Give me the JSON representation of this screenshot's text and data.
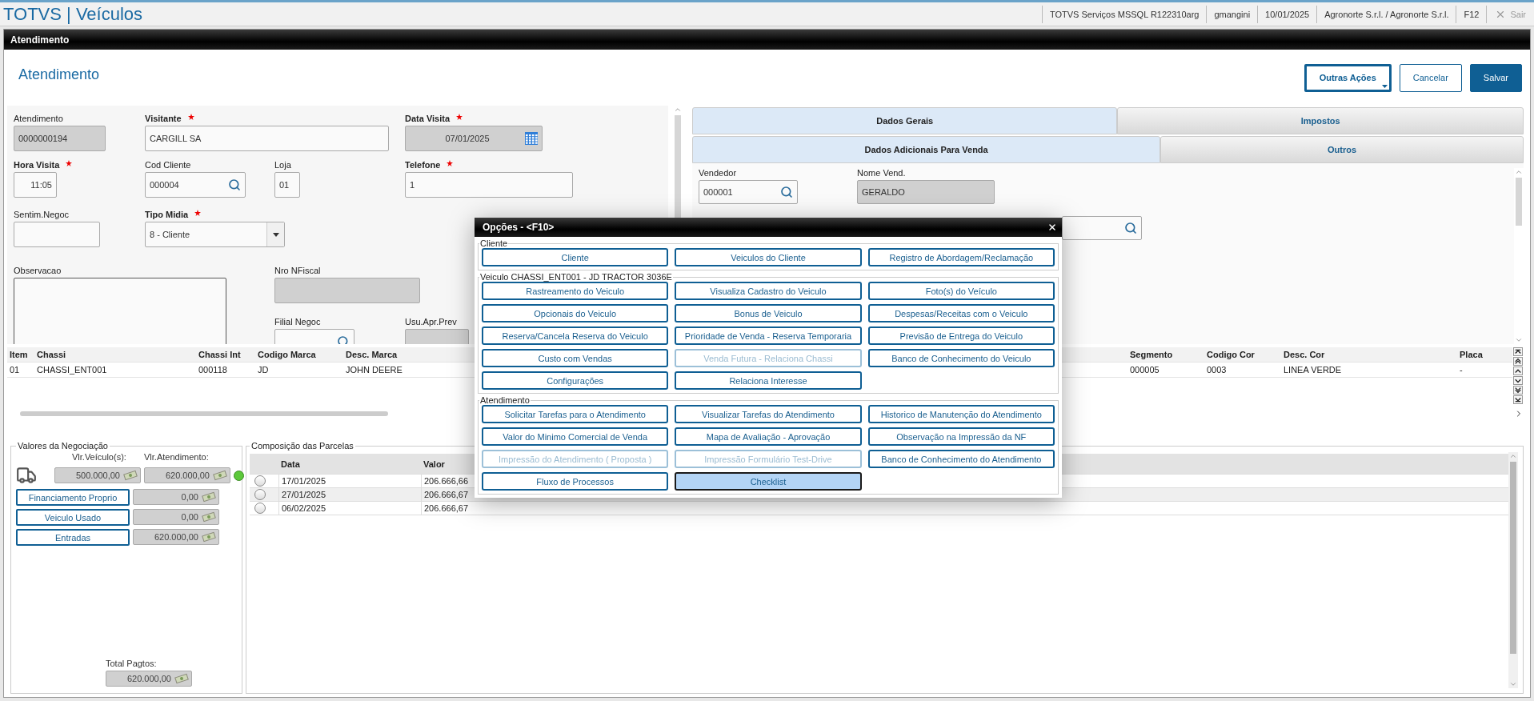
{
  "app": {
    "title": "TOTVS | Veículos",
    "status_items": [
      "TOTVS Serviços MSSQL R122310arg",
      "gmangini",
      "10/01/2025",
      "Agronorte S.r.l. / Agronorte S.r.l.",
      "F12"
    ],
    "exit": {
      "label": "Sair",
      "disabled": true
    }
  },
  "window": {
    "title": "Atendimento"
  },
  "header": {
    "title": "Atendimento",
    "buttons": [
      {
        "label": "Outras Ações",
        "kind": "menu"
      },
      {
        "label": "Cancelar",
        "kind": "secondary"
      },
      {
        "label": "Salvar",
        "kind": "primary"
      }
    ]
  },
  "form": {
    "fields": [
      {
        "label": "Atendimento",
        "required": false,
        "kind": "text",
        "readonly": true,
        "value": "0000000194"
      },
      {
        "label": "Visitante",
        "required": true,
        "kind": "text",
        "readonly": false,
        "value": "CARGILL SA"
      },
      {
        "label": "Data Visita",
        "required": true,
        "kind": "date",
        "readonly": true,
        "value": "07/01/2025"
      },
      {
        "label": "Hora Visita",
        "required": true,
        "kind": "time",
        "readonly": false,
        "value": "11:05"
      },
      {
        "label": "Cod Cliente",
        "required": false,
        "kind": "lookup",
        "readonly": false,
        "value": "000004"
      },
      {
        "label": "Loja",
        "required": false,
        "kind": "text",
        "readonly": false,
        "value": "01"
      },
      {
        "label": "Telefone",
        "required": true,
        "kind": "text",
        "readonly": false,
        "value": "1"
      },
      {
        "label": "Sentim.Negoc",
        "required": false,
        "kind": "text",
        "readonly": false
      },
      {
        "label": "Tipo Midia",
        "required": true,
        "kind": "select",
        "readonly": false,
        "value": "8 - Cliente"
      },
      {
        "label": "Observacao",
        "required": false,
        "kind": "textarea",
        "readonly": false
      },
      {
        "label": "Nro NFiscal",
        "required": false,
        "kind": "text",
        "readonly": true
      },
      {
        "label": "Filial Negoc",
        "required": false,
        "kind": "lookup",
        "readonly": false
      },
      {
        "label": "Usu.Apr.Prev",
        "required": false,
        "kind": "text",
        "readonly": true
      }
    ]
  },
  "tab_rows": [
    {
      "tabs": [
        {
          "label": "Dados Gerais",
          "selected": true
        },
        {
          "label": "Impostos",
          "selected": false
        }
      ]
    },
    {
      "tabs": [
        {
          "label": "Dados Adicionais Para Venda",
          "selected": true
        },
        {
          "label": "Outros",
          "selected": false
        }
      ]
    }
  ],
  "tab_fields": [
    {
      "label": "Vendedor",
      "kind": "lookup",
      "readonly": false,
      "value": "000001"
    },
    {
      "label": "Nome Vend.",
      "kind": "text",
      "readonly": true,
      "value": "GERALDO"
    },
    {
      "kind": "lookup",
      "readonly": false
    }
  ],
  "vehicles": {
    "columns": [
      "Item",
      "Chassi",
      "Chassi Int",
      "Codigo Marca",
      "Desc. Marca",
      "Segmento",
      "Codigo Cor",
      "Desc. Cor",
      "Placa"
    ],
    "rows": [
      [
        "01",
        "CHASSI_ENT001",
        "000118",
        "JD",
        "JOHN DEERE",
        "000005",
        "0003",
        "LINEA VERDE",
        "-"
      ]
    ]
  },
  "negotiation": {
    "title": "Valores da Negociação",
    "vehicle_label": "Vlr.Veículo(s):",
    "vehicle_value": "500.000,00",
    "service_label": "Vlr.Atendimento:",
    "service_value": "620.000,00",
    "balanced": true,
    "entries": [
      {
        "label": "Financiamento Proprio",
        "value": "0,00"
      },
      {
        "label": "Veiculo Usado",
        "value": "0,00"
      },
      {
        "label": "Entradas",
        "value": "620.000,00"
      }
    ],
    "total_label": "Total Pagtos:",
    "total_value": "620.000,00"
  },
  "installments": {
    "title": "Composição das Parcelas",
    "columns": [
      "Data",
      "Valor"
    ],
    "rows": [
      {
        "selected": false,
        "cells": [
          "17/01/2025",
          "206.666,66"
        ]
      },
      {
        "selected": false,
        "cells": [
          "27/01/2025",
          "206.666,67"
        ]
      },
      {
        "selected": false,
        "cells": [
          "06/02/2025",
          "206.666,67"
        ]
      }
    ]
  },
  "dialog": {
    "title": "Opções - <F10>",
    "groups": [
      {
        "title": "Cliente",
        "buttons": [
          {
            "label": "Cliente",
            "disabled": false,
            "selected": false
          },
          {
            "label": "Veiculos do Cliente",
            "disabled": false,
            "selected": false
          },
          {
            "label": "Registro de Abordagem/Reclamação",
            "disabled": false,
            "selected": false
          }
        ]
      },
      {
        "title": "Veiculo CHASSI_ENT001 - JD TRACTOR 3036E",
        "buttons": [
          {
            "label": "Rastreamento do Veiculo",
            "disabled": false,
            "selected": false
          },
          {
            "label": "Visualiza Cadastro do Veiculo",
            "disabled": false,
            "selected": false
          },
          {
            "label": "Foto(s) do Veículo",
            "disabled": false,
            "selected": false
          },
          {
            "label": "Opcionais do Veiculo",
            "disabled": false,
            "selected": false
          },
          {
            "label": "Bonus de Veiculo",
            "disabled": false,
            "selected": false
          },
          {
            "label": "Despesas/Receitas com o Veiculo",
            "disabled": false,
            "selected": false
          },
          {
            "label": "Reserva/Cancela Reserva do Veiculo",
            "disabled": false,
            "selected": false
          },
          {
            "label": "Prioridade de Venda - Reserva Temporaria",
            "disabled": false,
            "selected": false
          },
          {
            "label": "Previsão de Entrega do Veiculo",
            "disabled": false,
            "selected": false
          },
          {
            "label": "Custo com Vendas",
            "disabled": false,
            "selected": false
          },
          {
            "label": "Venda Futura - Relaciona Chassi",
            "disabled": true,
            "selected": false
          },
          {
            "label": "Banco de Conhecimento do Veiculo",
            "disabled": false,
            "selected": false
          },
          {
            "label": "Configurações",
            "disabled": false,
            "selected": false
          },
          {
            "label": "Relaciona Interesse",
            "disabled": false,
            "selected": false
          }
        ]
      },
      {
        "title": "Atendimento",
        "buttons": [
          {
            "label": "Solicitar Tarefas para o Atendimento",
            "disabled": false,
            "selected": false
          },
          {
            "label": "Visualizar Tarefas do Atendimento",
            "disabled": false,
            "selected": false
          },
          {
            "label": "Historico de Manutenção do Atendimento",
            "disabled": false,
            "selected": false
          },
          {
            "label": "Valor do Minimo Comercial de Venda",
            "disabled": false,
            "selected": false
          },
          {
            "label": "Mapa de Avaliação - Aprovação",
            "disabled": false,
            "selected": false
          },
          {
            "label": "Observação na Impressão da NF",
            "disabled": false,
            "selected": false
          },
          {
            "label": "Impressão do Atendimento ( Proposta )",
            "disabled": true,
            "selected": false
          },
          {
            "label": "Impressão Formulário Test-Drive",
            "disabled": true,
            "selected": false
          },
          {
            "label": "Banco de Conhecimento do Atendimento",
            "disabled": false,
            "selected": false
          },
          {
            "label": "Fluxo de Processos",
            "disabled": false,
            "selected": false
          },
          {
            "label": "Checklist",
            "disabled": false,
            "selected": true
          }
        ]
      }
    ]
  }
}
